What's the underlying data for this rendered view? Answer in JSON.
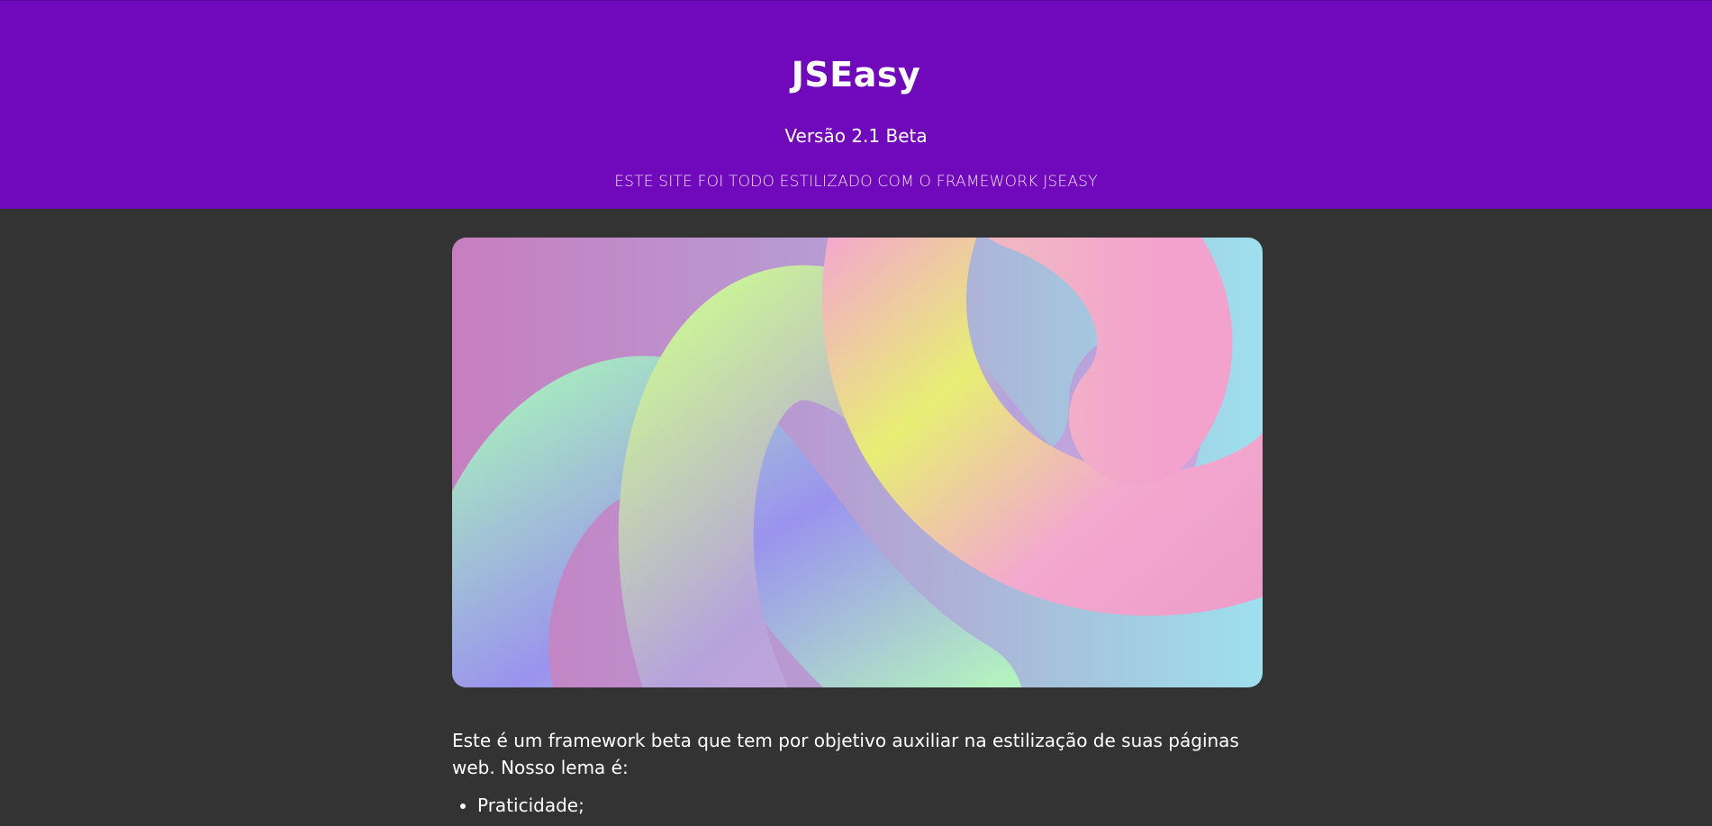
{
  "header": {
    "title": "JSEasy",
    "version": "Versão 2.1 Beta",
    "tagline": "ESTE SITE FOI TODO ESTILIZADO COM O FRAMEWORK JSEASY"
  },
  "main": {
    "intro": "Este é um framework beta que tem por objetivo auxiliar na estilização de suas páginas web. Nosso lema é:",
    "features": [
      "Praticidade;"
    ]
  },
  "colors": {
    "header_bg": "#7009bb",
    "page_bg": "#333333",
    "text": "#ffffff"
  }
}
